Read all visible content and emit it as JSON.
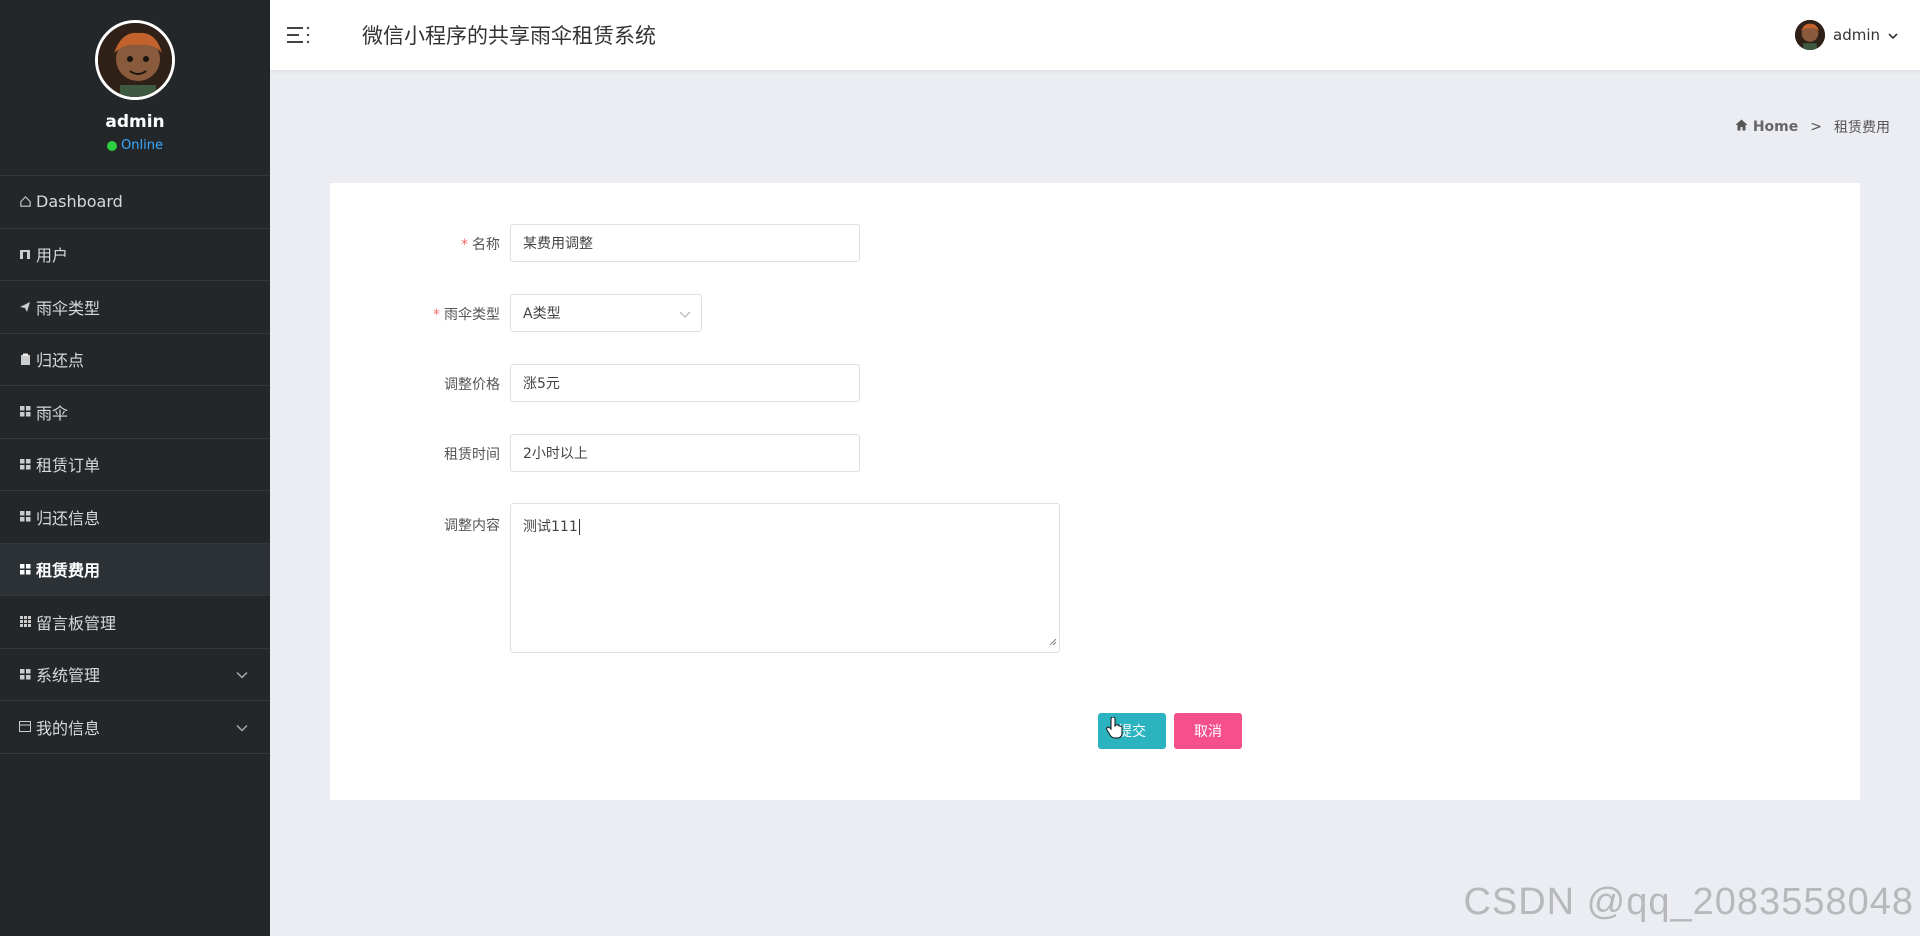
{
  "app": {
    "title": "微信小程序的共享雨伞租赁系统"
  },
  "user": {
    "name": "admin",
    "status": "Online"
  },
  "sidebar": {
    "items": [
      {
        "label": "Dashboard",
        "icon": "home-icon"
      },
      {
        "label": "用户",
        "icon": "user-icon"
      },
      {
        "label": "雨伞类型",
        "icon": "paper-plane-icon"
      },
      {
        "label": "归还点",
        "icon": "clipboard-icon"
      },
      {
        "label": "雨伞",
        "icon": "grid-icon"
      },
      {
        "label": "租赁订单",
        "icon": "grid-icon"
      },
      {
        "label": "归还信息",
        "icon": "grid-icon"
      },
      {
        "label": "租赁费用",
        "icon": "grid-icon",
        "active": true
      },
      {
        "label": "留言板管理",
        "icon": "grid-small-icon"
      },
      {
        "label": "系统管理",
        "icon": "grid-icon",
        "expandable": true
      },
      {
        "label": "我的信息",
        "icon": "id-card-icon",
        "expandable": true
      }
    ]
  },
  "breadcrumb": {
    "home": "Home",
    "separator": ">",
    "current": "租赁费用"
  },
  "form": {
    "name": {
      "label": "名称",
      "required": true,
      "value": "某费用调整"
    },
    "type": {
      "label": "雨伞类型",
      "required": true,
      "value": "A类型"
    },
    "price": {
      "label": "调整价格",
      "value": "涨5元"
    },
    "time": {
      "label": "租赁时间",
      "value": "2小时以上"
    },
    "content": {
      "label": "调整内容",
      "value": "测试111"
    },
    "submit": "提交",
    "cancel": "取消"
  },
  "watermark": "CSDN @qq_2083558048",
  "colors": {
    "sidebar_bg": "#23272a",
    "submit": "#2bb3c0",
    "cancel": "#f5508b",
    "required": "#f56c6c"
  }
}
